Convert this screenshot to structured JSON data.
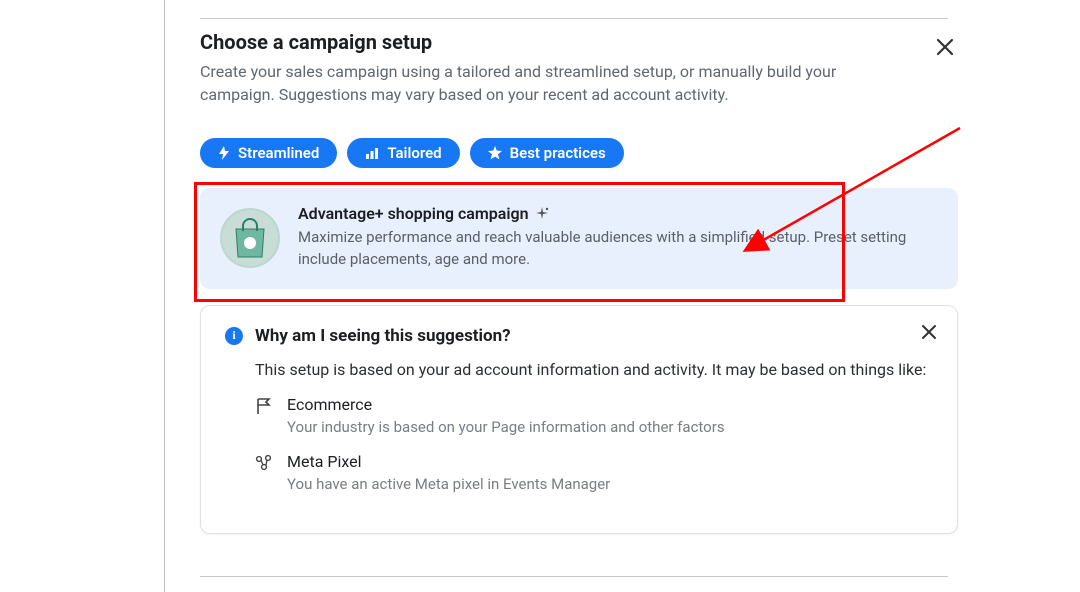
{
  "header": {
    "title": "Choose a campaign setup",
    "subtitle": "Create your sales campaign using a tailored and streamlined setup, or manually build your campaign. Suggestions may vary based on your recent ad account activity."
  },
  "chips": {
    "streamlined": "Streamlined",
    "tailored": "Tailored",
    "best_practices": "Best practices"
  },
  "card": {
    "title": "Advantage+ shopping campaign",
    "desc": "Maximize performance and reach valuable audiences with a simplified setup. Preset setting include placements, age and more."
  },
  "info": {
    "title": "Why am I seeing this suggestion?",
    "desc": "This setup is based on your ad account information and activity. It may be based on things like:",
    "reasons": {
      "ecommerce": {
        "title": "Ecommerce",
        "desc": "Your industry is based on your Page information and other factors"
      },
      "pixel": {
        "title": "Meta Pixel",
        "desc": "You have an active Meta pixel in Events Manager"
      }
    }
  }
}
